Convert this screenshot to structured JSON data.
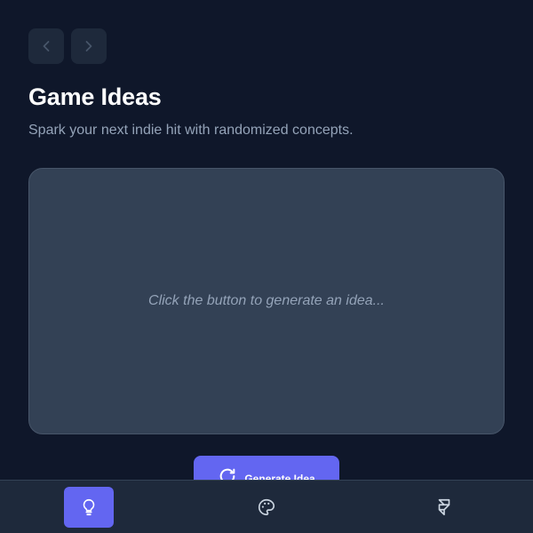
{
  "header": {
    "title": "Game Ideas",
    "subtitle": "Spark your next indie hit with randomized concepts."
  },
  "nav": {
    "back_icon": "chevron-left-icon",
    "forward_icon": "chevron-right-icon"
  },
  "idea_card": {
    "placeholder": "Click the button to generate an idea..."
  },
  "generate_button": {
    "label": "Generate Idea",
    "icon": "refresh-icon"
  },
  "bottom_nav": {
    "tabs": [
      {
        "icon": "lightbulb-icon",
        "active": true
      },
      {
        "icon": "palette-icon",
        "active": false
      },
      {
        "icon": "framer-icon",
        "active": false
      }
    ]
  },
  "colors": {
    "background": "#0f172a",
    "surface": "#1e293b",
    "card": "#334155",
    "accent": "#6366f1",
    "muted_text": "#94a3b8"
  }
}
